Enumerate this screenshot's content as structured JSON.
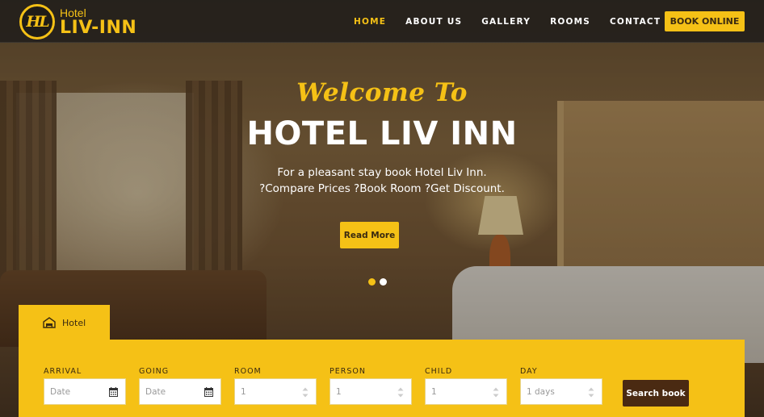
{
  "brand": {
    "mark": "HL",
    "prefix": "Hotel",
    "name": "LIV-INN"
  },
  "nav": {
    "items": [
      {
        "label": "HOME",
        "active": true
      },
      {
        "label": "ABOUT US",
        "active": false
      },
      {
        "label": "GALLERY",
        "active": false
      },
      {
        "label": "ROOMS",
        "active": false
      },
      {
        "label": "CONTACT US",
        "active": false
      }
    ],
    "cta_label": "BOOK ONLINE"
  },
  "hero": {
    "welcome": "Welcome To",
    "title": "HOTEL LIV INN",
    "subtitle_line1": "For a pleasant stay book Hotel Liv Inn.",
    "subtitle_line2": "?Compare Prices ?Book Room ?Get Discount.",
    "button_label": "Read More",
    "slides": 2,
    "active_slide": 1
  },
  "booking": {
    "tab_label": "Hotel",
    "tab_icon": "hotel-icon",
    "fields": [
      {
        "label": "ARRIVAL",
        "value": "Date",
        "icon": "calendar-icon"
      },
      {
        "label": "GOING",
        "value": "Date",
        "icon": "calendar-icon"
      },
      {
        "label": "ROOM",
        "value": "1",
        "icon": "spinner-icon"
      },
      {
        "label": "PERSON",
        "value": "1",
        "icon": "spinner-icon"
      },
      {
        "label": "CHILD",
        "value": "1",
        "icon": "spinner-icon"
      },
      {
        "label": "DAY",
        "value": "1 days",
        "icon": "spinner-icon"
      }
    ],
    "search_label": "Search book"
  },
  "colors": {
    "accent": "#f5c116",
    "dark": "#4a2a12",
    "nav_bg": "#221f1c"
  }
}
